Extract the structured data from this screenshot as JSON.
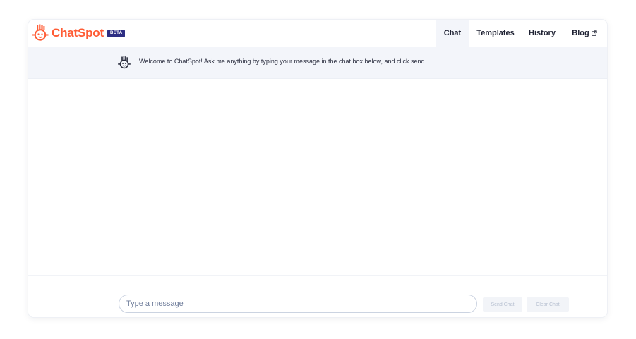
{
  "brand": {
    "name": "ChatSpot",
    "badge": "BETA",
    "color": "#ff5c35",
    "badge_color": "#2d2e83"
  },
  "nav": {
    "items": [
      {
        "label": "Chat",
        "active": true
      },
      {
        "label": "Templates",
        "active": false
      },
      {
        "label": "History",
        "active": false
      },
      {
        "label": "Blog",
        "active": false,
        "icon": "external-link-icon"
      }
    ]
  },
  "welcome": {
    "message": "Welcome to ChatSpot! Ask me anything by typing your message in the chat box below, and click send."
  },
  "composer": {
    "placeholder": "Type a message",
    "value": "",
    "send_label": "Send Chat",
    "clear_label": "Clear Chat"
  }
}
